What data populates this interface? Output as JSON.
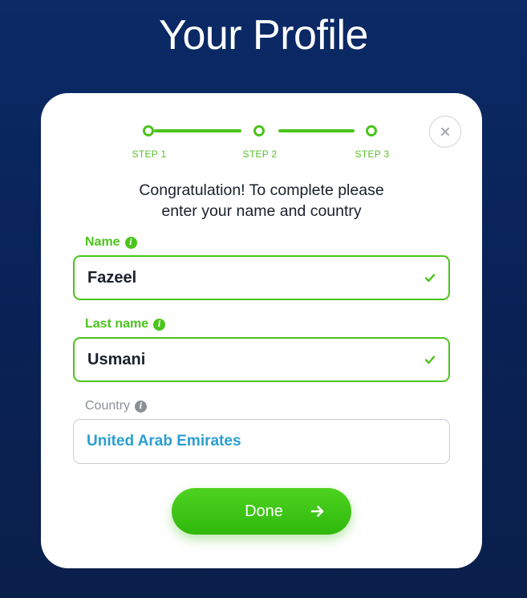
{
  "page": {
    "title": "Your Profile"
  },
  "stepper": {
    "steps": [
      {
        "label": "STEP 1"
      },
      {
        "label": "STEP 2"
      },
      {
        "label": "STEP 3"
      }
    ],
    "active_color": "#4bc41b"
  },
  "close": {
    "icon": "close-icon"
  },
  "intro": {
    "line1": "Congratulation! To complete please",
    "line2": "enter your name and country"
  },
  "form": {
    "name": {
      "label": "Name",
      "value": "Fazeel",
      "state": "valid"
    },
    "last_name": {
      "label": "Last name",
      "value": "Usmani",
      "state": "valid"
    },
    "country": {
      "label": "Country",
      "value": "United Arab Emirates",
      "state": "neutral"
    }
  },
  "actions": {
    "done_label": "Done",
    "done_icon": "arrow-right-icon"
  },
  "colors": {
    "background": "#0a2660",
    "accent": "#4bc41b",
    "link": "#2a9fd0",
    "text": "#1a1f2b"
  }
}
